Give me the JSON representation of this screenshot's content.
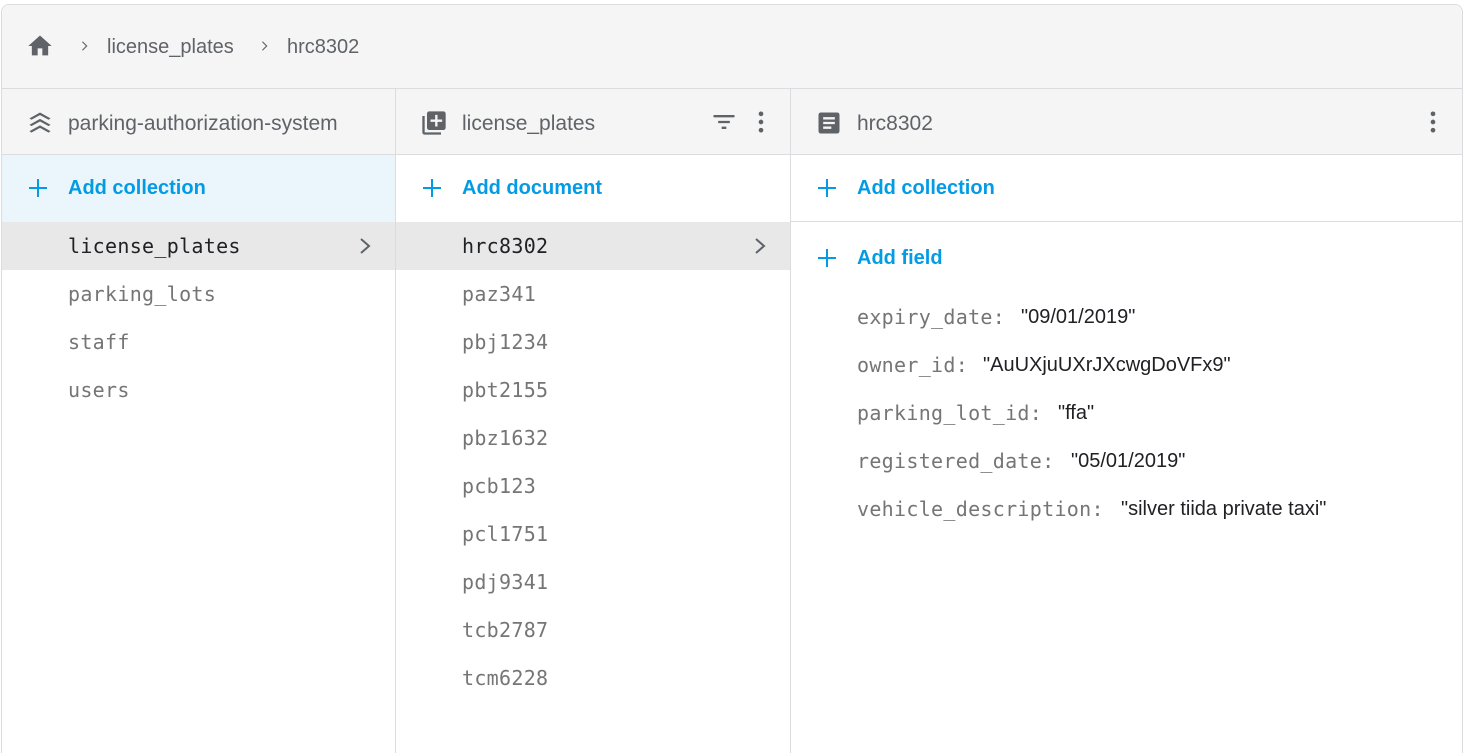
{
  "breadcrumb": {
    "icon": "home-icon",
    "items": [
      "license_plates",
      "hrc8302"
    ]
  },
  "colors": {
    "accent": "#039be5",
    "selected_row": "#e8e8e8",
    "header_bg": "#f5f5f5",
    "tint": "#eaf6fc"
  },
  "root_panel": {
    "icon": "stack-layers-icon",
    "title": "parking-authorization-system",
    "add_label": "Add collection",
    "items": [
      {
        "label": "license_plates",
        "selected": true
      },
      {
        "label": "parking_lots",
        "selected": false
      },
      {
        "label": "staff",
        "selected": false
      },
      {
        "label": "users",
        "selected": false
      }
    ]
  },
  "collection_panel": {
    "icon": "collection-icon",
    "title": "license_plates",
    "filter_icon": "filter-icon",
    "menu_icon": "more-vert-icon",
    "add_label": "Add document",
    "items": [
      {
        "label": "hrc8302",
        "selected": true
      },
      {
        "label": "paz341",
        "selected": false
      },
      {
        "label": "pbj1234",
        "selected": false
      },
      {
        "label": "pbt2155",
        "selected": false
      },
      {
        "label": "pbz1632",
        "selected": false
      },
      {
        "label": "pcb123",
        "selected": false
      },
      {
        "label": "pcl1751",
        "selected": false
      },
      {
        "label": "pdj9341",
        "selected": false
      },
      {
        "label": "tcb2787",
        "selected": false
      },
      {
        "label": "tcm6228",
        "selected": false
      }
    ]
  },
  "document_panel": {
    "icon": "document-icon",
    "title": "hrc8302",
    "menu_icon": "more-vert-icon",
    "add_collection_label": "Add collection",
    "add_field_label": "Add field",
    "fields": [
      {
        "key": "expiry_date:",
        "value": "\"09/01/2019\""
      },
      {
        "key": "owner_id:",
        "value": "\"AuUXjuUXrJXcwgDoVFx9\""
      },
      {
        "key": "parking_lot_id:",
        "value": "\"ffa\""
      },
      {
        "key": "registered_date:",
        "value": "\"05/01/2019\""
      },
      {
        "key": "vehicle_description:",
        "value": "\"silver tiida private taxi\""
      }
    ]
  }
}
